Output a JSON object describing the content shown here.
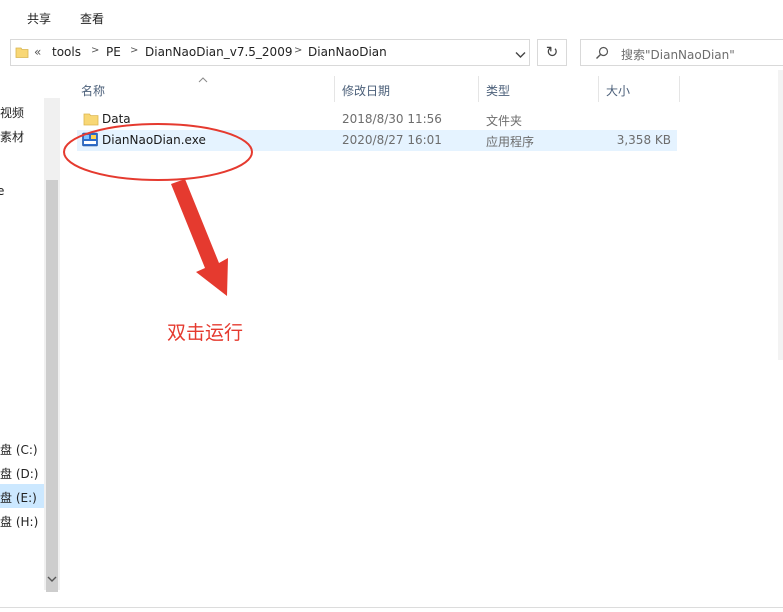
{
  "ribbon": {
    "tabs": [
      "共享",
      "查看"
    ]
  },
  "address": {
    "overflow": "«",
    "crumbs": [
      "tools",
      "PE",
      "DianNaoDian_v7.5_2009",
      "DianNaoDian"
    ]
  },
  "search": {
    "placeholder": "搜索\"DianNaoDian\""
  },
  "nav": {
    "items": [
      "视频",
      "素材",
      "e",
      "盘 (C:)",
      "盘 (D:)",
      "盘 (E:)",
      "盘 (H:)"
    ]
  },
  "columns": {
    "name": "名称",
    "modified": "修改日期",
    "type": "类型",
    "size": "大小"
  },
  "files": [
    {
      "name": "Data",
      "modified": "2018/8/30 11:56",
      "type": "文件夹",
      "size": ""
    },
    {
      "name": "DianNaoDian.exe",
      "modified": "2020/8/27 16:01",
      "type": "应用程序",
      "size": "3,358 KB"
    }
  ],
  "annotation": {
    "text": "双击运行",
    "color": "#e53a2f"
  },
  "colors": {
    "selection": "#e5f3ff",
    "folder": "#f8d775",
    "header_text": "#4c607a"
  }
}
